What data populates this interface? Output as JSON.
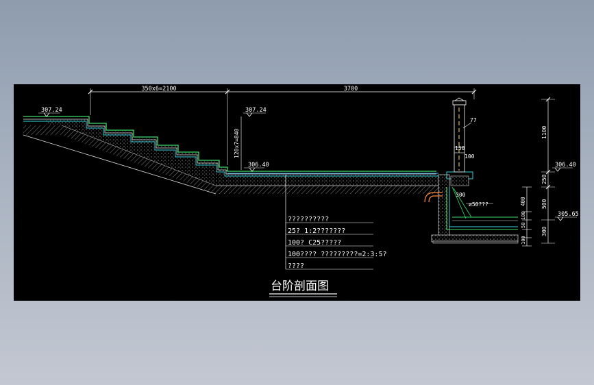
{
  "drawing": {
    "title": "台阶剖面图",
    "dimensions": {
      "top_left": "350x6=2100",
      "top_right": "3700",
      "stair_rise": "120x7=840",
      "right_1100": "1100",
      "right_250": "250",
      "right_400": "400",
      "right_500": "500",
      "right_100a": "100",
      "right_50": "50",
      "right_100b": "100",
      "right_300": "300"
    },
    "elevations": {
      "top_left": "307.24",
      "stair_top": "307.24",
      "landing": "306.40",
      "right_upper": "306.40",
      "pool": "305.65"
    },
    "details": {
      "post_77": "77",
      "post_150": "150",
      "post_100": "100",
      "channel_300": "300",
      "pipe": "ø50???"
    },
    "notes": [
      "??????????",
      "25? 1:2???????",
      "100? C25?????",
      "100????   ?????????=2:3:5?",
      "????"
    ]
  }
}
